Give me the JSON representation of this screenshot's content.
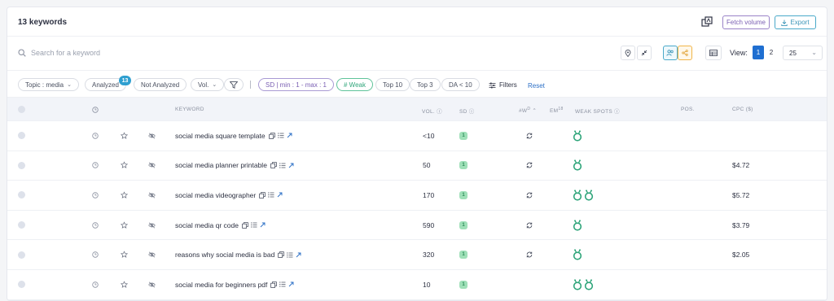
{
  "header": {
    "title": "13 keywords",
    "fetch_volume_label": "Fetch volume",
    "export_label": "Export"
  },
  "search": {
    "placeholder": "Search for a keyword",
    "view_label": "View:",
    "pages": [
      "1",
      "2"
    ],
    "active_page": "1",
    "per_page": "25"
  },
  "filters": {
    "topic": "Topic : media",
    "analyzed": "Analyzed",
    "analyzed_count": "13",
    "not_analyzed": "Not Analyzed",
    "vol": "Vol.",
    "sd_range": "SD | min : 1 - max : 1",
    "weak": "# Weak",
    "top10": "Top 10",
    "top3": "Top 3",
    "da": "DA < 10",
    "filters_label": "Filters",
    "reset_label": "Reset"
  },
  "table": {
    "columns": {
      "keyword": "KEYWORD",
      "vol": "VOL.",
      "sd": "SD",
      "w": "#W",
      "w_sup": "D",
      "em": "EM",
      "em_sup": "18",
      "weak_spots": "WEAK SPOTS",
      "pos": "POS.",
      "cpc": "CPC ($)"
    },
    "rows": [
      {
        "keyword": "social media square template",
        "vol": "<10",
        "sd": "1",
        "refresh": true,
        "weak_spots": 1,
        "cpc": ""
      },
      {
        "keyword": "social media planner printable",
        "vol": "50",
        "sd": "1",
        "refresh": true,
        "weak_spots": 1,
        "cpc": "$4.72"
      },
      {
        "keyword": "social media videographer",
        "vol": "170",
        "sd": "1",
        "refresh": true,
        "weak_spots": 2,
        "cpc": "$5.72"
      },
      {
        "keyword": "social media qr code",
        "vol": "590",
        "sd": "1",
        "refresh": true,
        "weak_spots": 1,
        "cpc": "$3.79"
      },
      {
        "keyword": "reasons why social media is bad",
        "vol": "320",
        "sd": "1",
        "refresh": true,
        "weak_spots": 1,
        "cpc": "$2.05"
      },
      {
        "keyword": "social media for beginners pdf",
        "vol": "10",
        "sd": "1",
        "refresh": false,
        "weak_spots": 2,
        "cpc": ""
      }
    ]
  },
  "colors": {
    "accent_blue": "#1f6fd1",
    "weak_green": "#2fa57a",
    "purple": "#7a5fb3",
    "teal": "#3b95b8",
    "badge_blue": "#2f9fd0"
  },
  "icons": [
    "search-icon",
    "location-pin-icon",
    "collapse-arrows-icon",
    "users-icon",
    "share-icon",
    "table-view-icon",
    "funnel-icon",
    "sliders-icon",
    "download-icon",
    "stack-icon",
    "clock-icon",
    "star-icon",
    "eye-off-icon",
    "copy-icon",
    "list-icon",
    "external-link-icon",
    "refresh-icon",
    "reddit-icon"
  ]
}
